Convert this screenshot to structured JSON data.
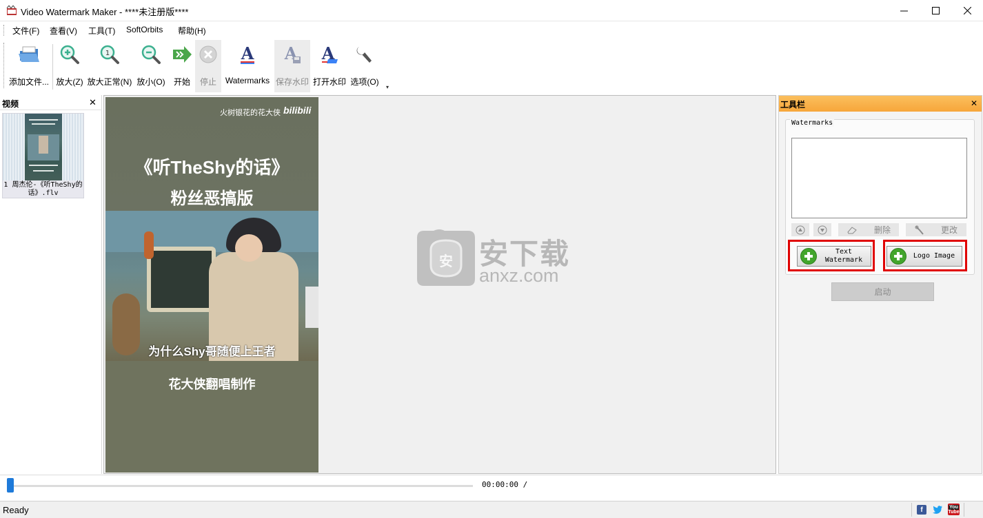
{
  "window": {
    "title": "Video Watermark Maker - ****未注册版****",
    "controls": {
      "minimize": "—",
      "maximize": "☐",
      "close": "✕"
    }
  },
  "menu": [
    "文件(F)",
    "查看(V)",
    "工具(T)",
    "SoftOrbits",
    "帮助(H)"
  ],
  "toolbar": {
    "items": [
      {
        "label": "添加文件...",
        "icon": "add-files-icon",
        "enabled": true
      },
      {
        "label": "放大(Z)",
        "icon": "zoom-in-icon",
        "enabled": true
      },
      {
        "label": "放大正常(N)",
        "icon": "zoom-normal-icon",
        "enabled": true
      },
      {
        "label": "放小(O)",
        "icon": "zoom-out-icon",
        "enabled": true
      },
      {
        "label": "开始",
        "icon": "start-arrow-icon",
        "enabled": true
      },
      {
        "label": "停止",
        "icon": "stop-icon",
        "enabled": false
      },
      {
        "label": "Watermarks",
        "icon": "watermarks-icon",
        "enabled": true
      },
      {
        "label": "保存水印",
        "icon": "save-watermark-icon",
        "enabled": false
      },
      {
        "label": "打开水印",
        "icon": "open-watermark-icon",
        "enabled": true
      },
      {
        "label": "选项(O)",
        "icon": "options-wrench-icon",
        "enabled": true
      }
    ],
    "overflow": "▾"
  },
  "left_panel": {
    "title": "视频",
    "close": "✕",
    "video_item": {
      "caption": "1  周杰伦-《听TheShy的话》.flv"
    }
  },
  "preview": {
    "frame": {
      "channel": "火树银花的花大侠",
      "logo": "bilibili",
      "title_line1": "《听TheShy的话》",
      "title_line2": "粉丝恶搞版",
      "subtitle1": "为什么Shy哥随便上王者",
      "subtitle2": "花大侠翻唱制作"
    },
    "overlay": {
      "brand_cn": "安下载",
      "brand_en": "anxz.com",
      "badge": "安"
    }
  },
  "right_panel": {
    "title": "工具栏",
    "close": "✕",
    "watermarks_group": "Watermarks",
    "tools": [
      {
        "label": "",
        "icon": "move-up-icon"
      },
      {
        "label": "",
        "icon": "move-down-icon"
      },
      {
        "label": "删除",
        "icon": "eraser-delete-icon"
      },
      {
        "label": "更改",
        "icon": "edit-wrench-icon"
      }
    ],
    "add_text_watermark": "Text\nWatermark",
    "add_logo_image": "Logo Image",
    "start_button": "启动"
  },
  "timeline": {
    "time": "00:00:00 /",
    "progress": 0
  },
  "status": {
    "text": "Ready",
    "social": [
      "facebook-icon",
      "twitter-icon",
      "youtube-icon"
    ]
  },
  "colors": {
    "panel_header": "#f7a63a",
    "highlight_box": "#e00000",
    "plus_green": "#43a52c",
    "timeline_thumb": "#1e7ad9"
  }
}
